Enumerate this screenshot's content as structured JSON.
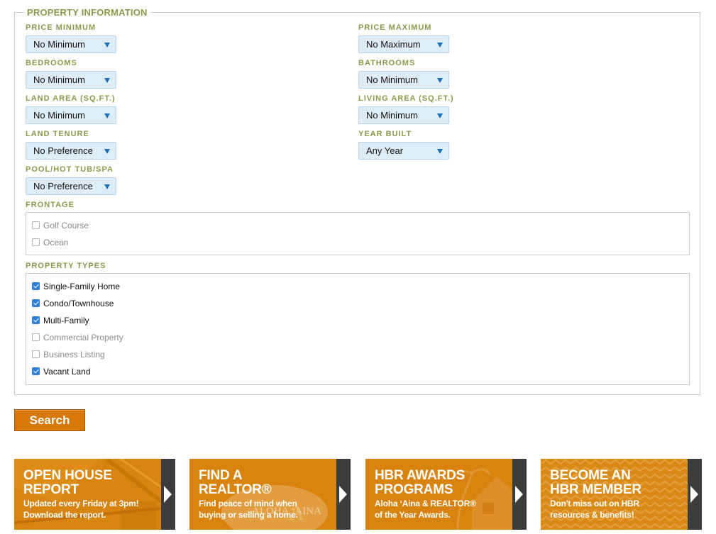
{
  "form": {
    "legend": "PROPERTY INFORMATION",
    "fields": {
      "price_min": {
        "label": "PRICE MINIMUM",
        "value": "No Minimum"
      },
      "price_max": {
        "label": "PRICE MAXIMUM",
        "value": "No Maximum"
      },
      "bedrooms": {
        "label": "BEDROOMS",
        "value": "No Minimum"
      },
      "bathrooms": {
        "label": "BATHROOMS",
        "value": "No Minimum"
      },
      "land_area": {
        "label": "LAND AREA (SQ.FT.)",
        "value": "No Minimum"
      },
      "living_area": {
        "label": "LIVING AREA (SQ.FT.)",
        "value": "No Minimum"
      },
      "land_tenure": {
        "label": "LAND TENURE",
        "value": "No Preference"
      },
      "year_built": {
        "label": "YEAR BUILT",
        "value": "Any Year"
      },
      "pool": {
        "label": "POOL/HOT TUB/SPA",
        "value": "No Preference"
      }
    },
    "frontage": {
      "label": "FRONTAGE",
      "options": [
        {
          "label": "Golf Course",
          "checked": false
        },
        {
          "label": "Ocean",
          "checked": false
        }
      ]
    },
    "property_types": {
      "label": "PROPERTY TYPES",
      "options": [
        {
          "label": "Single-Family Home",
          "checked": true
        },
        {
          "label": "Condo/Townhouse",
          "checked": true
        },
        {
          "label": "Multi-Family",
          "checked": true
        },
        {
          "label": "Commercial Property",
          "checked": false
        },
        {
          "label": "Business Listing",
          "checked": false
        },
        {
          "label": "Vacant Land",
          "checked": true
        }
      ]
    },
    "search_label": "Search"
  },
  "promos": [
    {
      "title1": "OPEN HOUSE",
      "title2": "REPORT",
      "sub1": "Updated every Friday at 3pm!",
      "sub2": "Download the report."
    },
    {
      "title1": "FIND A",
      "title2": "REALTOR®",
      "sub1": "Find peace of mind when",
      "sub2": "buying or selling a home.",
      "logo_text": "ALOHA ʻAINA"
    },
    {
      "title1": "HBR AWARDS",
      "title2": "PROGRAMS",
      "sub1": "Aloha ʻAina & REALTOR®",
      "sub2": "of the Year Awards."
    },
    {
      "title1": "BECOME AN",
      "title2": "HBR MEMBER",
      "sub1": "Don't miss out on HBR",
      "sub2": "resources & benefits!"
    }
  ],
  "colors": {
    "label_green": "#8a9a4a",
    "select_bg": "#dcedf8",
    "accent_orange": "#d9780a",
    "tile_side": "#3c3c3c"
  }
}
